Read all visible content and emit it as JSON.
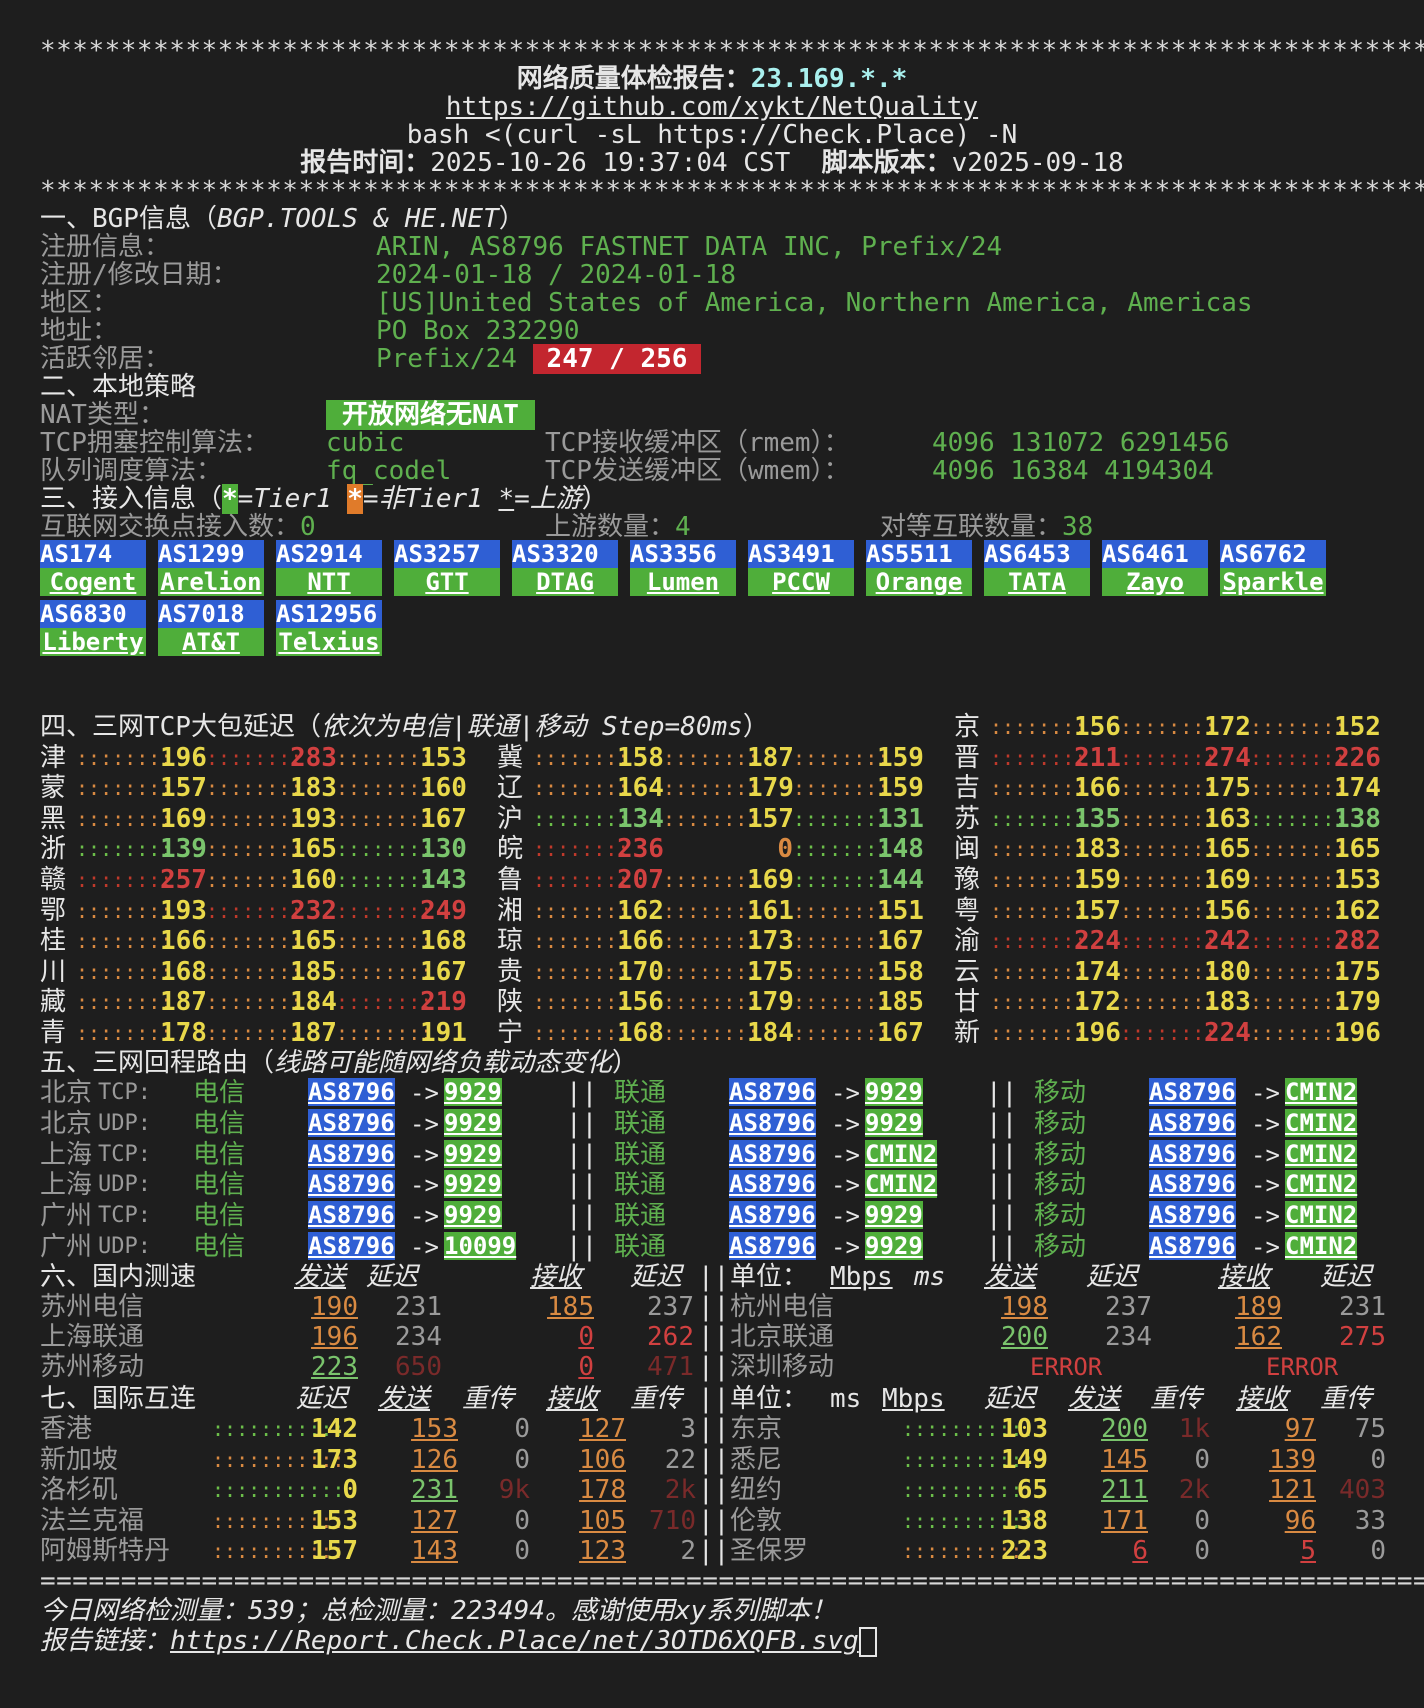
{
  "stars": "****************************************************************************************",
  "header": {
    "title_prefix": "网络质量体检报告：",
    "ip": "23.169.*.*",
    "repo_url": "https://github.com/xykt/NetQuality",
    "command": "bash <(curl -sL https://Check.Place) -N",
    "time_label": "报告时间：",
    "time": "2025-10-26 19:37:04 CST",
    "version_label": "脚本版本：",
    "version": "v2025-09-18"
  },
  "bgp": {
    "heading": "一、BGP信息（",
    "heading_src": "BGP.TOOLS & HE.NET",
    "heading_end": "）",
    "reg_label": "注册信息：",
    "reg": "ARIN, AS8796 FASTNET DATA INC, Prefix/24",
    "date_label": "注册/修改日期：",
    "date": "2024-01-18 / 2024-01-18",
    "region_label": "地区：",
    "region": "[US]United States of America, Northern America, Americas",
    "addr_label": "地址：",
    "addr": "PO Box 232290",
    "neighbor_label": "活跃邻居：",
    "neighbor_prefix": "Prefix/24",
    "neighbor_badge": "247 / 256"
  },
  "policy": {
    "heading": "二、本地策略",
    "nat_label": "NAT类型：",
    "nat": "开放网络无NAT",
    "cc_label": "TCP拥塞控制算法：",
    "cc": "cubic",
    "rmem_label": "TCP接收缓冲区（rmem）：",
    "rmem": "4096 131072 6291456",
    "qdisc_label": "队列调度算法：",
    "qdisc": "fq_codel",
    "wmem_label": "TCP发送缓冲区（wmem）：",
    "wmem": "4096 16384 4194304"
  },
  "access": {
    "heading": "三、接入信息（",
    "m1": "*",
    "t1": "=Tier1 ",
    "m2": "*",
    "t2": "=非Tier1 ",
    "m3": "*",
    "t3": "=上游",
    "end": "）",
    "ix_label": "互联网交换点接入数：",
    "ix": "0",
    "up_label": "上游数量：",
    "up": "4",
    "peer_label": "对等互联数量：",
    "peer": "38",
    "asns": [
      {
        "as": "AS174",
        "name": "Cogent"
      },
      {
        "as": "AS1299",
        "name": "Arelion"
      },
      {
        "as": "AS2914",
        "name": "NTT"
      },
      {
        "as": "AS3257",
        "name": "GTT"
      },
      {
        "as": "AS3320",
        "name": "DTAG"
      },
      {
        "as": "AS3356",
        "name": "Lumen"
      },
      {
        "as": "AS3491",
        "name": "PCCW"
      },
      {
        "as": "AS5511",
        "name": "Orange"
      },
      {
        "as": "AS6453",
        "name": "TATA"
      },
      {
        "as": "AS6461",
        "name": "Zayo"
      },
      {
        "as": "AS6762",
        "name": "Sparkle"
      },
      {
        "as": "AS6830",
        "name": "Liberty"
      },
      {
        "as": "AS7018",
        "name": "AT&T"
      },
      {
        "as": "AS12956",
        "name": "Telxius"
      }
    ]
  },
  "latency": {
    "heading": "四、三网TCP大包延迟（",
    "heading_it": "依次为电信|联通|移动 Step=80ms",
    "heading_end": "）",
    "rows": [
      [
        {
          "p": "京",
          "v": [
            "156",
            "172",
            "152"
          ]
        }
      ],
      [
        {
          "p": "津",
          "v": [
            "196",
            "283",
            "153"
          ]
        },
        {
          "p": "冀",
          "v": [
            "158",
            "187",
            "159"
          ]
        },
        {
          "p": "晋",
          "v": [
            "211",
            "274",
            "226"
          ]
        }
      ],
      [
        {
          "p": "蒙",
          "v": [
            "157",
            "183",
            "160"
          ]
        },
        {
          "p": "辽",
          "v": [
            "164",
            "179",
            "159"
          ]
        },
        {
          "p": "吉",
          "v": [
            "166",
            "175",
            "174"
          ]
        }
      ],
      [
        {
          "p": "黑",
          "v": [
            "169",
            "193",
            "167"
          ]
        },
        {
          "p": "沪",
          "v": [
            "134",
            "157",
            "131"
          ]
        },
        {
          "p": "苏",
          "v": [
            "135",
            "163",
            "138"
          ]
        }
      ],
      [
        {
          "p": "浙",
          "v": [
            "139",
            "165",
            "130"
          ]
        },
        {
          "p": "皖",
          "v": [
            "236",
            "0",
            "148"
          ]
        },
        {
          "p": "闽",
          "v": [
            "183",
            "165",
            "165"
          ]
        }
      ],
      [
        {
          "p": "赣",
          "v": [
            "257",
            "160",
            "143"
          ]
        },
        {
          "p": "鲁",
          "v": [
            "207",
            "169",
            "144"
          ]
        },
        {
          "p": "豫",
          "v": [
            "159",
            "169",
            "153"
          ]
        }
      ],
      [
        {
          "p": "鄂",
          "v": [
            "193",
            "232",
            "249"
          ]
        },
        {
          "p": "湘",
          "v": [
            "162",
            "161",
            "151"
          ]
        },
        {
          "p": "粤",
          "v": [
            "157",
            "156",
            "162"
          ]
        }
      ],
      [
        {
          "p": "桂",
          "v": [
            "166",
            "165",
            "168"
          ]
        },
        {
          "p": "琼",
          "v": [
            "166",
            "173",
            "167"
          ]
        },
        {
          "p": "渝",
          "v": [
            "224",
            "242",
            "282"
          ]
        }
      ],
      [
        {
          "p": "川",
          "v": [
            "168",
            "185",
            "167"
          ]
        },
        {
          "p": "贵",
          "v": [
            "170",
            "175",
            "158"
          ]
        },
        {
          "p": "云",
          "v": [
            "174",
            "180",
            "175"
          ]
        }
      ],
      [
        {
          "p": "藏",
          "v": [
            "187",
            "184",
            "219"
          ]
        },
        {
          "p": "陕",
          "v": [
            "156",
            "179",
            "185"
          ]
        },
        {
          "p": "甘",
          "v": [
            "172",
            "183",
            "179"
          ]
        }
      ],
      [
        {
          "p": "青",
          "v": [
            "178",
            "187",
            "191"
          ]
        },
        {
          "p": "宁",
          "v": [
            "168",
            "184",
            "167"
          ]
        },
        {
          "p": "新",
          "v": [
            "196",
            "224",
            "196"
          ]
        }
      ]
    ]
  },
  "route": {
    "heading": "五、三网回程路由（",
    "heading_it": "线路可能随网络负载动态变化",
    "heading_end": "）",
    "ct": "电信",
    "cu": "联通",
    "cm": "移动",
    "sep": "||",
    "arrow": "->",
    "rows": [
      {
        "city": "北京",
        "proto": "TCP:",
        "ct": [
          "AS8796",
          "9929"
        ],
        "cu": [
          "AS8796",
          "9929"
        ],
        "cm": [
          "AS8796",
          "CMIN2"
        ]
      },
      {
        "city": "北京",
        "proto": "UDP:",
        "ct": [
          "AS8796",
          "9929"
        ],
        "cu": [
          "AS8796",
          "9929"
        ],
        "cm": [
          "AS8796",
          "CMIN2"
        ]
      },
      {
        "city": "上海",
        "proto": "TCP:",
        "ct": [
          "AS8796",
          "9929"
        ],
        "cu": [
          "AS8796",
          "CMIN2"
        ],
        "cm": [
          "AS8796",
          "CMIN2"
        ]
      },
      {
        "city": "上海",
        "proto": "UDP:",
        "ct": [
          "AS8796",
          "9929"
        ],
        "cu": [
          "AS8796",
          "CMIN2"
        ],
        "cm": [
          "AS8796",
          "CMIN2"
        ]
      },
      {
        "city": "广州",
        "proto": "TCP:",
        "ct": [
          "AS8796",
          "9929"
        ],
        "cu": [
          "AS8796",
          "9929"
        ],
        "cm": [
          "AS8796",
          "CMIN2"
        ]
      },
      {
        "city": "广州",
        "proto": "UDP:",
        "ct": [
          "AS8796",
          "10099"
        ],
        "cu": [
          "AS8796",
          "9929"
        ],
        "cm": [
          "AS8796",
          "CMIN2"
        ]
      }
    ]
  },
  "domestic": {
    "heading": "六、国内测速",
    "send": "发送",
    "lat": "延迟",
    "recv": "接收",
    "lat2": "延迟",
    "sep": "||",
    "unit_label": "单位：",
    "unit1": "Mbps",
    "unit2": "ms",
    "rows": [
      {
        "l": "苏州电信",
        "lv": [
          "190",
          "231",
          "185",
          "237"
        ],
        "r": "杭州电信",
        "rv": [
          "198",
          "237",
          "189",
          "231"
        ]
      },
      {
        "l": "上海联通",
        "lv": [
          "196",
          "234",
          "0",
          "262"
        ],
        "r": "北京联通",
        "rv": [
          "200",
          "234",
          "162",
          "275"
        ]
      },
      {
        "l": "苏州移动",
        "lv": [
          "223",
          "650",
          "0",
          "471"
        ],
        "r": "深圳移动",
        "rv": [
          "ERROR",
          "ERROR"
        ]
      }
    ]
  },
  "intl": {
    "heading": "七、国际互连",
    "lat": "延迟",
    "send": "发送",
    "re": "重传",
    "recv": "接收",
    "re2": "重传",
    "sep": "||",
    "unit_label": "单位：",
    "unit1": "ms",
    "unit2": "Mbps",
    "rows": [
      {
        "l": "香港",
        "lv": [
          "142",
          "153",
          "0",
          "127",
          "3"
        ],
        "r": "东京",
        "rv": [
          "103",
          "200",
          "1k",
          "97",
          "75"
        ]
      },
      {
        "l": "新加坡",
        "lv": [
          "173",
          "126",
          "0",
          "106",
          "22"
        ],
        "r": "悉尼",
        "rv": [
          "149",
          "145",
          "0",
          "139",
          "0"
        ]
      },
      {
        "l": "洛杉矶",
        "lv": [
          "0",
          "231",
          "9k",
          "178",
          "2k"
        ],
        "r": "纽约",
        "rv": [
          "65",
          "211",
          "2k",
          "121",
          "403"
        ]
      },
      {
        "l": "法兰克福",
        "lv": [
          "153",
          "127",
          "0",
          "105",
          "710"
        ],
        "r": "伦敦",
        "rv": [
          "138",
          "171",
          "0",
          "96",
          "33"
        ]
      },
      {
        "l": "阿姆斯特丹",
        "lv": [
          "157",
          "143",
          "0",
          "123",
          "2"
        ],
        "r": "圣保罗",
        "rv": [
          "223",
          "6",
          "0",
          "5",
          "0"
        ]
      }
    ]
  },
  "footer": {
    "eq": "==========================================================================================",
    "count_text": "今日网络检测量：539；总检测量：223494。感谢使用xy系列脚本！",
    "link_label": "报告链接：",
    "link": "https://Report.Check.Place/net/3OTD6XQFB.svg"
  },
  "colors": {
    "bg": "#1e1e1e",
    "blue": "#2f5fd4",
    "green": "#4fae3a",
    "red": "#c3262f",
    "orange": "#e07b2a",
    "yellow": "#e8d84a"
  }
}
